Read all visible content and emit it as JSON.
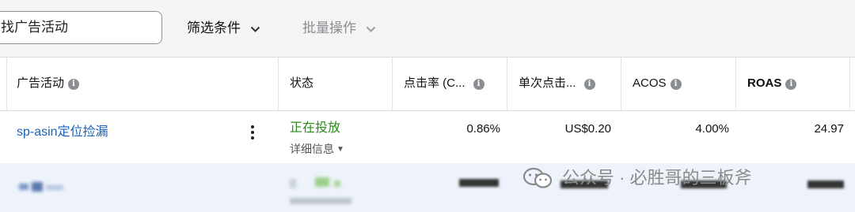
{
  "toolbar": {
    "search_value": "找广告活动",
    "filter_label": "筛选条件",
    "bulk_label": "批量操作"
  },
  "table": {
    "headers": [
      {
        "label": "广告活动",
        "info": true
      },
      {
        "label": "状态",
        "info": false
      },
      {
        "label": "点击率 (C...",
        "info": true
      },
      {
        "label": "单次点击...",
        "info": true
      },
      {
        "label": "ACOS",
        "info": true
      },
      {
        "label": "ROAS",
        "info": true
      }
    ],
    "rows": [
      {
        "campaign": "sp-asin定位捡漏",
        "status": "正在投放",
        "status_detail": "详细信息",
        "ctr": "0.86%",
        "cpc": "US$0.20",
        "acos": "4.00%",
        "roas": "24.97"
      }
    ]
  },
  "watermark": {
    "text": "公众号 · 必胜哥的三板斧"
  },
  "colors": {
    "link": "#1a63b8",
    "status_active": "#2b8a18",
    "selected_row": "#eef3fb"
  }
}
